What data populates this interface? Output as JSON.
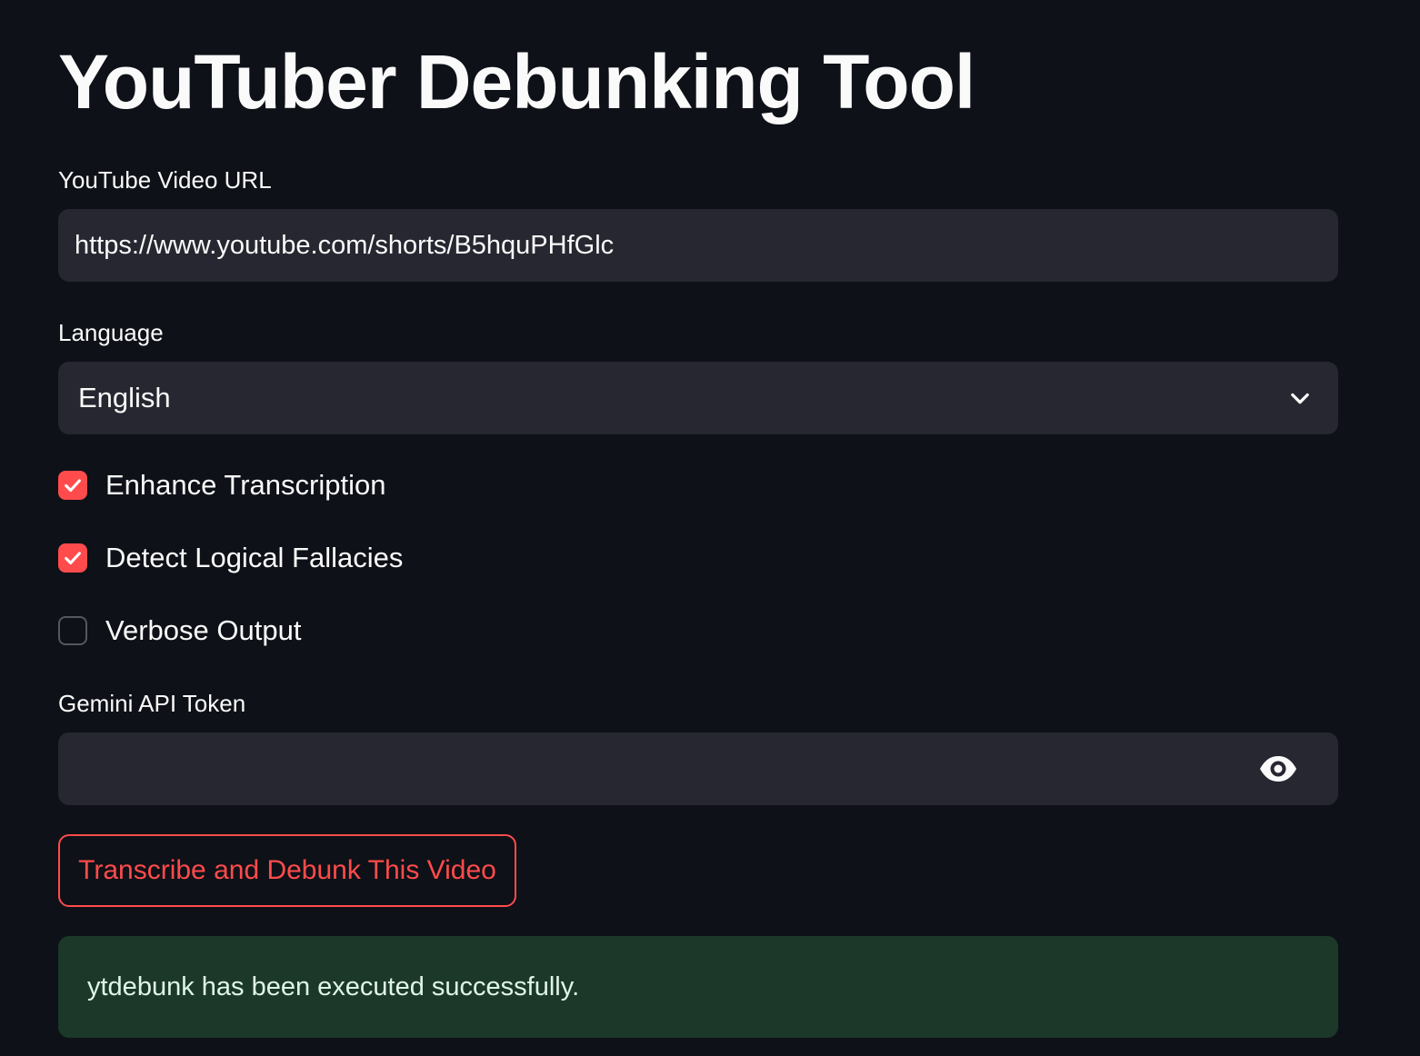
{
  "title": "YouTuber Debunking Tool",
  "url_field": {
    "label": "YouTube Video URL",
    "value": "https://www.youtube.com/shorts/B5hquPHfGlc"
  },
  "language_field": {
    "label": "Language",
    "selected": "English",
    "icon": "chevron-down-icon"
  },
  "options": [
    {
      "label": "Enhance Transcription",
      "checked": true
    },
    {
      "label": "Detect Logical Fallacies",
      "checked": true
    },
    {
      "label": "Verbose Output",
      "checked": false
    }
  ],
  "token_field": {
    "label": "Gemini API Token",
    "value": "",
    "icon": "eye-icon"
  },
  "submit_button": {
    "label": "Transcribe and Debunk This Video"
  },
  "status": {
    "message": "ytdebunk has been executed successfully."
  },
  "colors": {
    "background": "#0e1117",
    "field": "#262730",
    "accent": "#ff4b4b",
    "success_bg": "#1b3829",
    "text": "#fafafa"
  }
}
